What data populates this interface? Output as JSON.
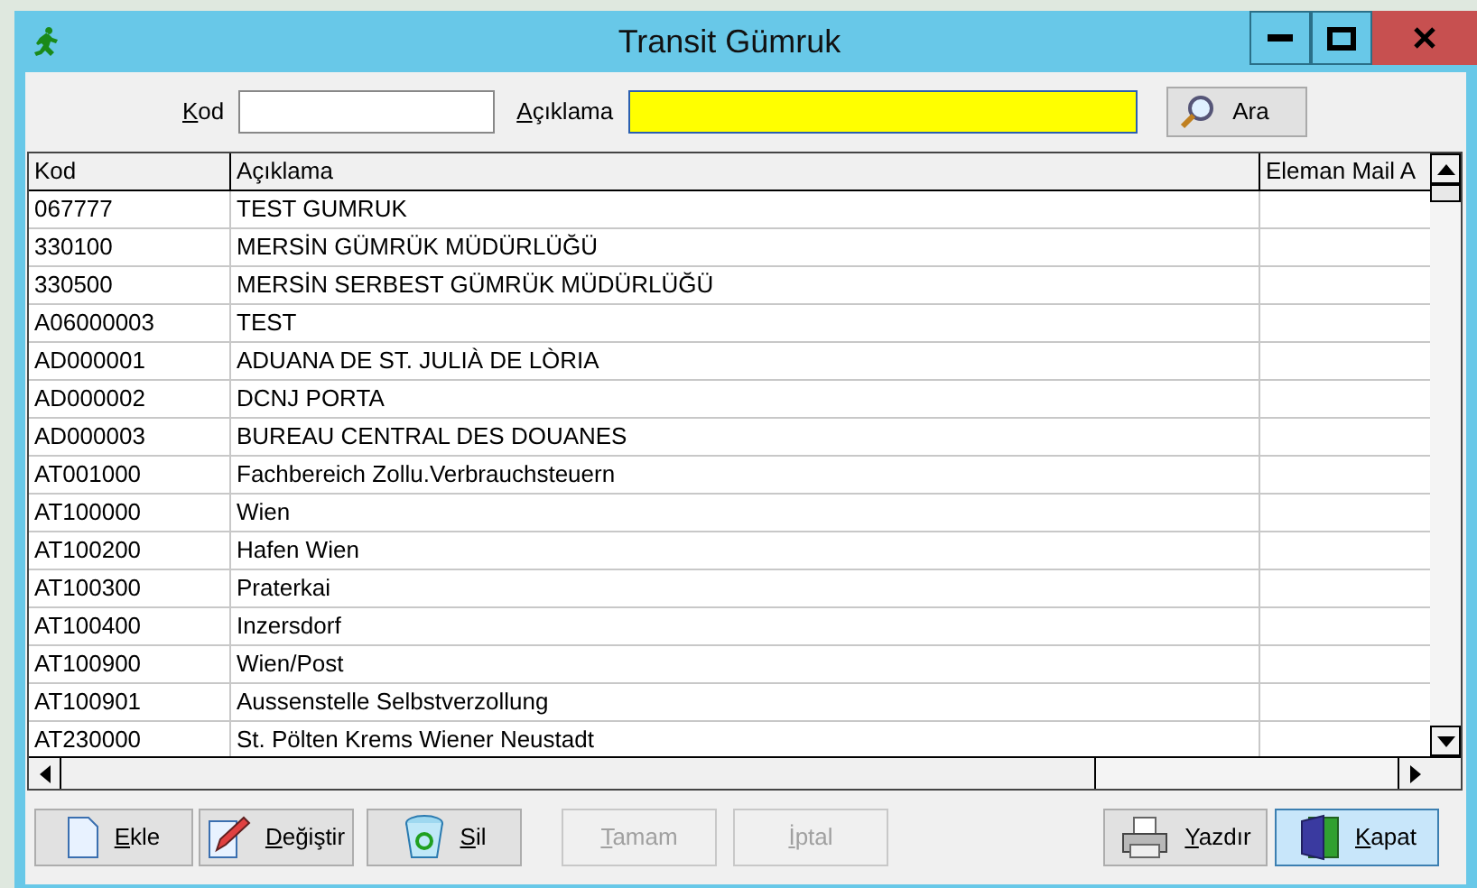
{
  "window": {
    "title": "Transit Gümruk"
  },
  "search": {
    "fields": [
      {
        "label": "Kod",
        "mnemonic": true,
        "highlighted": false
      },
      {
        "label": "Açıklama",
        "mnemonic": true,
        "highlighted": true
      }
    ],
    "button": "Ara"
  },
  "table": {
    "columns": [
      "Kod",
      "Açıklama",
      "Eleman Mail A"
    ],
    "rows": [
      [
        "067777",
        "TEST GUMRUK",
        ""
      ],
      [
        "330100",
        "MERSİN GÜMRÜK MÜDÜRLÜĞÜ",
        ""
      ],
      [
        "330500",
        "MERSİN SERBEST GÜMRÜK MÜDÜRLÜĞÜ",
        ""
      ],
      [
        "A06000003",
        "TEST",
        ""
      ],
      [
        "AD000001",
        "ADUANA DE ST. JULIÀ DE LÒRIA",
        ""
      ],
      [
        "AD000002",
        "DCNJ PORTA",
        ""
      ],
      [
        "AD000003",
        "BUREAU CENTRAL DES DOUANES",
        ""
      ],
      [
        "AT001000",
        "Fachbereich Zollu.Verbrauchsteuern",
        ""
      ],
      [
        "AT100000",
        "Wien",
        ""
      ],
      [
        "AT100200",
        "Hafen Wien",
        ""
      ],
      [
        "AT100300",
        "Praterkai",
        ""
      ],
      [
        "AT100400",
        "Inzersdorf",
        ""
      ],
      [
        "AT100900",
        "Wien/Post",
        ""
      ],
      [
        "AT100901",
        "Aussenstelle Selbstverzollung",
        ""
      ],
      [
        "AT230000",
        "St. Pölten Krems Wiener Neustadt",
        ""
      ]
    ]
  },
  "buttons": [
    {
      "kind": "new",
      "label": "Ekle",
      "disabled": false,
      "focused": false
    },
    {
      "kind": "edit",
      "label": "Değiştir",
      "disabled": false,
      "focused": false
    },
    {
      "kind": "delete",
      "label": "Sil",
      "disabled": false,
      "focused": false
    },
    {
      "kind": "ok",
      "label": "Tamam",
      "disabled": true,
      "focused": false
    },
    {
      "kind": "cancel",
      "label": "İptal",
      "disabled": true,
      "focused": false
    },
    {
      "kind": "print",
      "label": "Yazdır",
      "disabled": false,
      "focused": false
    },
    {
      "kind": "close",
      "label": "Kapat",
      "disabled": false,
      "focused": true
    }
  ]
}
